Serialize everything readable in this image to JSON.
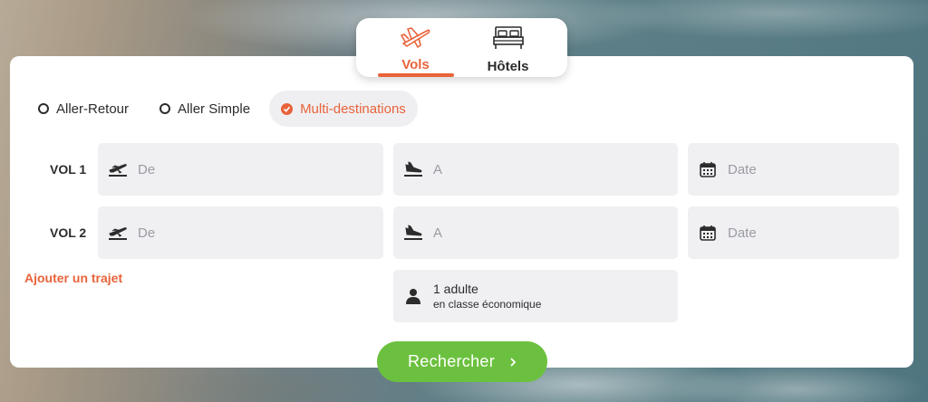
{
  "tabs": [
    {
      "label": "Vols",
      "icon": "airplane-icon",
      "active": true
    },
    {
      "label": "Hôtels",
      "icon": "bed-icon",
      "active": false
    }
  ],
  "trip_types": [
    {
      "label": "Aller-Retour",
      "selected": false
    },
    {
      "label": "Aller Simple",
      "selected": false
    },
    {
      "label": "Multi-destinations",
      "selected": true
    }
  ],
  "flights": [
    {
      "label": "VOL 1",
      "from_placeholder": "De",
      "to_placeholder": "A",
      "date_placeholder": "Date"
    },
    {
      "label": "VOL 2",
      "from_placeholder": "De",
      "to_placeholder": "A",
      "date_placeholder": "Date"
    }
  ],
  "add_trip_label": "Ajouter un trajet",
  "passengers": {
    "main": "1 adulte",
    "sub": "en classe économique"
  },
  "search_button": "Rechercher",
  "colors": {
    "accent": "#e8633a",
    "search_green": "#6cc03f",
    "field_bg": "#f0f0f3"
  }
}
